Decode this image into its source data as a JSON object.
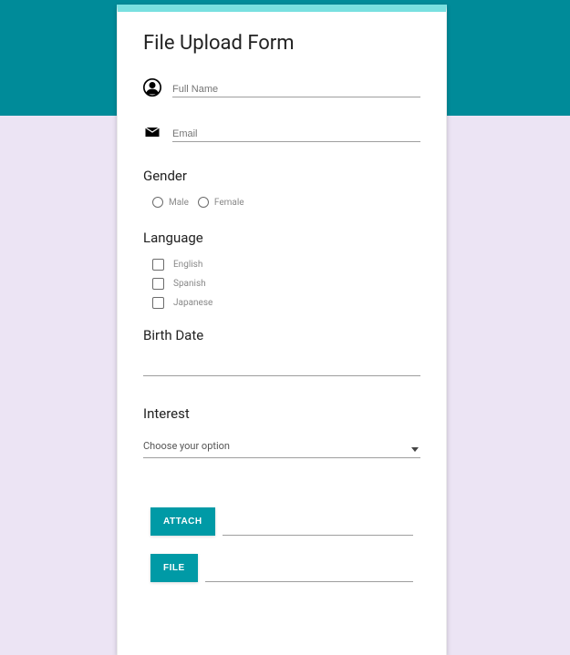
{
  "title": "File Upload Form",
  "fields": {
    "fullNamePlaceholder": "Full Name",
    "emailPlaceholder": "Email"
  },
  "gender": {
    "label": "Gender",
    "options": [
      "Male",
      "Female"
    ]
  },
  "language": {
    "label": "Language",
    "options": [
      "English",
      "Spanish",
      "Japanese"
    ]
  },
  "birthDate": {
    "label": "Birth Date"
  },
  "interest": {
    "label": "Interest",
    "placeholder": "Choose your option"
  },
  "buttons": {
    "attach": "ATTACH",
    "file": "FILE"
  }
}
